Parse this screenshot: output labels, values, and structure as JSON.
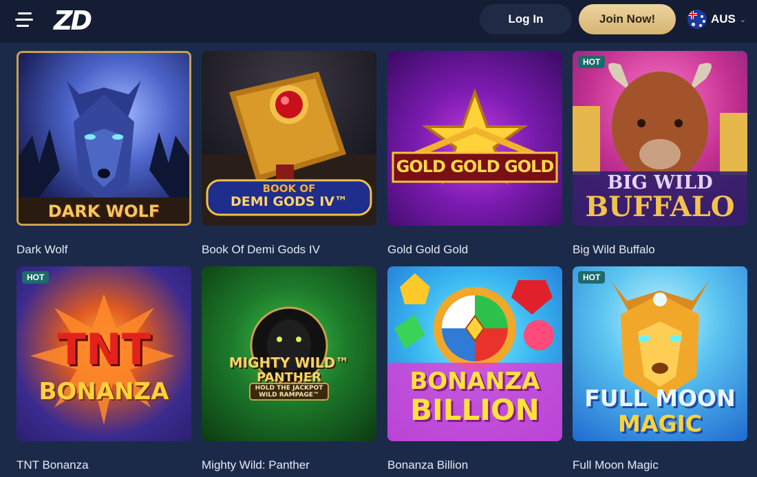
{
  "header": {
    "logo_text": "ZD",
    "login_label": "Log In",
    "join_label": "Join Now!",
    "region": {
      "flag_icon": "australia-flag-icon",
      "label": "AUS"
    }
  },
  "games": [
    {
      "title": "Dark Wolf",
      "hot": false,
      "art_text": [
        "DARK WOLF"
      ]
    },
    {
      "title": "Book Of Demi Gods IV",
      "hot": false,
      "art_text": [
        "BOOK OF",
        "DEMI GODS IV™"
      ]
    },
    {
      "title": "Gold Gold Gold",
      "hot": false,
      "art_text": [
        "GOLD GOLD GOLD"
      ]
    },
    {
      "title": "Big Wild Buffalo",
      "hot": true,
      "art_text": [
        "BIG WILD",
        "BUFFALO"
      ]
    },
    {
      "title": "TNT Bonanza",
      "hot": true,
      "art_text": [
        "TNT",
        "BONANZA"
      ]
    },
    {
      "title": "Mighty Wild: Panther",
      "hot": false,
      "art_text": [
        "MIGHTY WILD™",
        "PANTHER",
        "HOLD THE JACKPOT",
        "WILD RAMPAGE™"
      ]
    },
    {
      "title": "Bonanza Billion",
      "hot": false,
      "art_text": [
        "BONANZA",
        "BILLION"
      ]
    },
    {
      "title": "Full Moon Magic",
      "hot": true,
      "art_text": [
        "FULL MOON",
        "MAGIC"
      ]
    }
  ],
  "badges": {
    "hot_label": "HOT"
  },
  "colors": {
    "page_bg": "#1c2a4a",
    "header_bg": "#141d33",
    "join_gold": "#e0c083",
    "hot_badge": "#1e6a6a"
  }
}
